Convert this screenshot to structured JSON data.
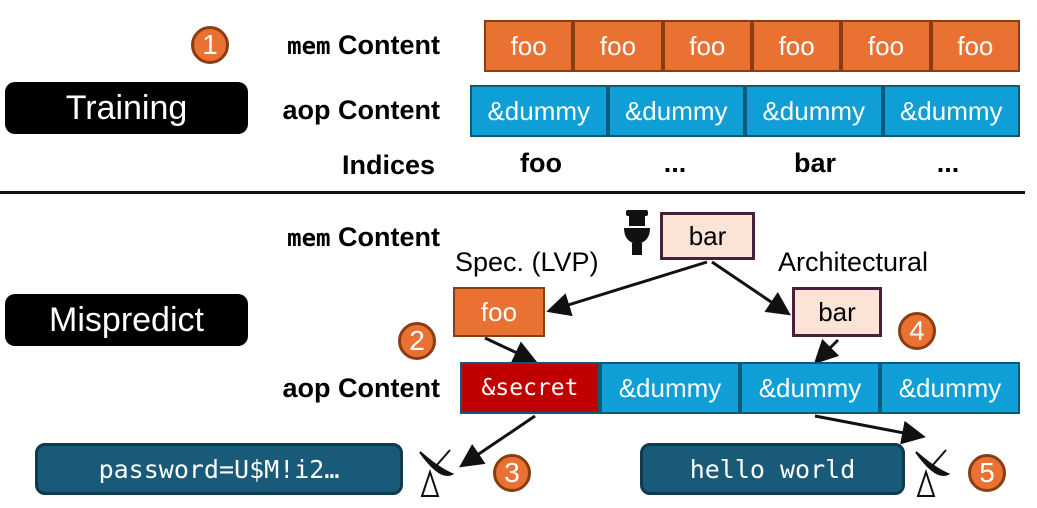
{
  "training": {
    "label": "Training",
    "step": "1",
    "mem_label_prefix": "mem",
    "mem_label": "Content",
    "aop_label": "aop Content",
    "indices_label": "Indices",
    "mem_cells": [
      "foo",
      "foo",
      "foo",
      "foo",
      "foo",
      "foo"
    ],
    "aop_cells": [
      "&dummy",
      "&dummy",
      "&dummy",
      "&dummy"
    ],
    "indices": [
      "foo",
      "...",
      "bar",
      "..."
    ]
  },
  "mispredict": {
    "label": "Mispredict",
    "mem_label_prefix": "mem",
    "mem_label": "Content",
    "aop_label": "aop Content",
    "mem_value": "bar",
    "spec_label": "Spec. (LVP)",
    "spec_value": "foo",
    "arch_label": "Architectural",
    "arch_value": "bar",
    "aop_cells": [
      "&secret",
      "&dummy",
      "&dummy",
      "&dummy"
    ],
    "leak_left": "password=U$M!i2…",
    "leak_right": "hello world",
    "steps": [
      "2",
      "3",
      "4",
      "5"
    ]
  },
  "colors": {
    "orange": "#e97132",
    "blue": "#0f9ed5",
    "secret": "#c00000",
    "light": "#fbe3d6",
    "terminal": "#195a78"
  },
  "icons": [
    "flush-toilet-icon",
    "satellite-dish-icon"
  ]
}
